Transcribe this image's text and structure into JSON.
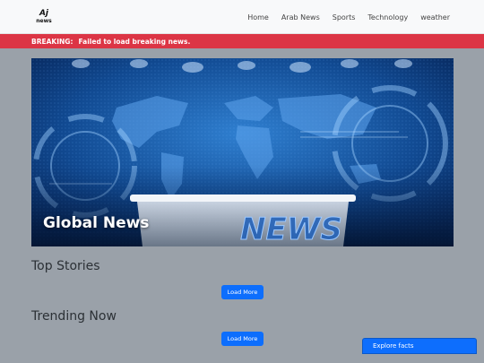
{
  "nav": {
    "logo_top": "Aj",
    "logo_bottom": "news",
    "links": [
      "Home",
      "Arab News",
      "Sports",
      "Technology",
      "weather"
    ]
  },
  "breaking": {
    "label": "BREAKING:",
    "message": "Failed to load breaking news."
  },
  "hero": {
    "title": "Global News",
    "image_text": "NEWS"
  },
  "sections": {
    "top_stories": {
      "title": "Top Stories",
      "button": "Load More"
    },
    "trending": {
      "title": "Trending Now",
      "button": "Load More"
    }
  },
  "explore": {
    "label": "Explore facts"
  },
  "colors": {
    "background": "#9aa1a9",
    "navbar": "#f8f9fa",
    "breaking": "#dc3545",
    "primary": "#0d6efd"
  }
}
